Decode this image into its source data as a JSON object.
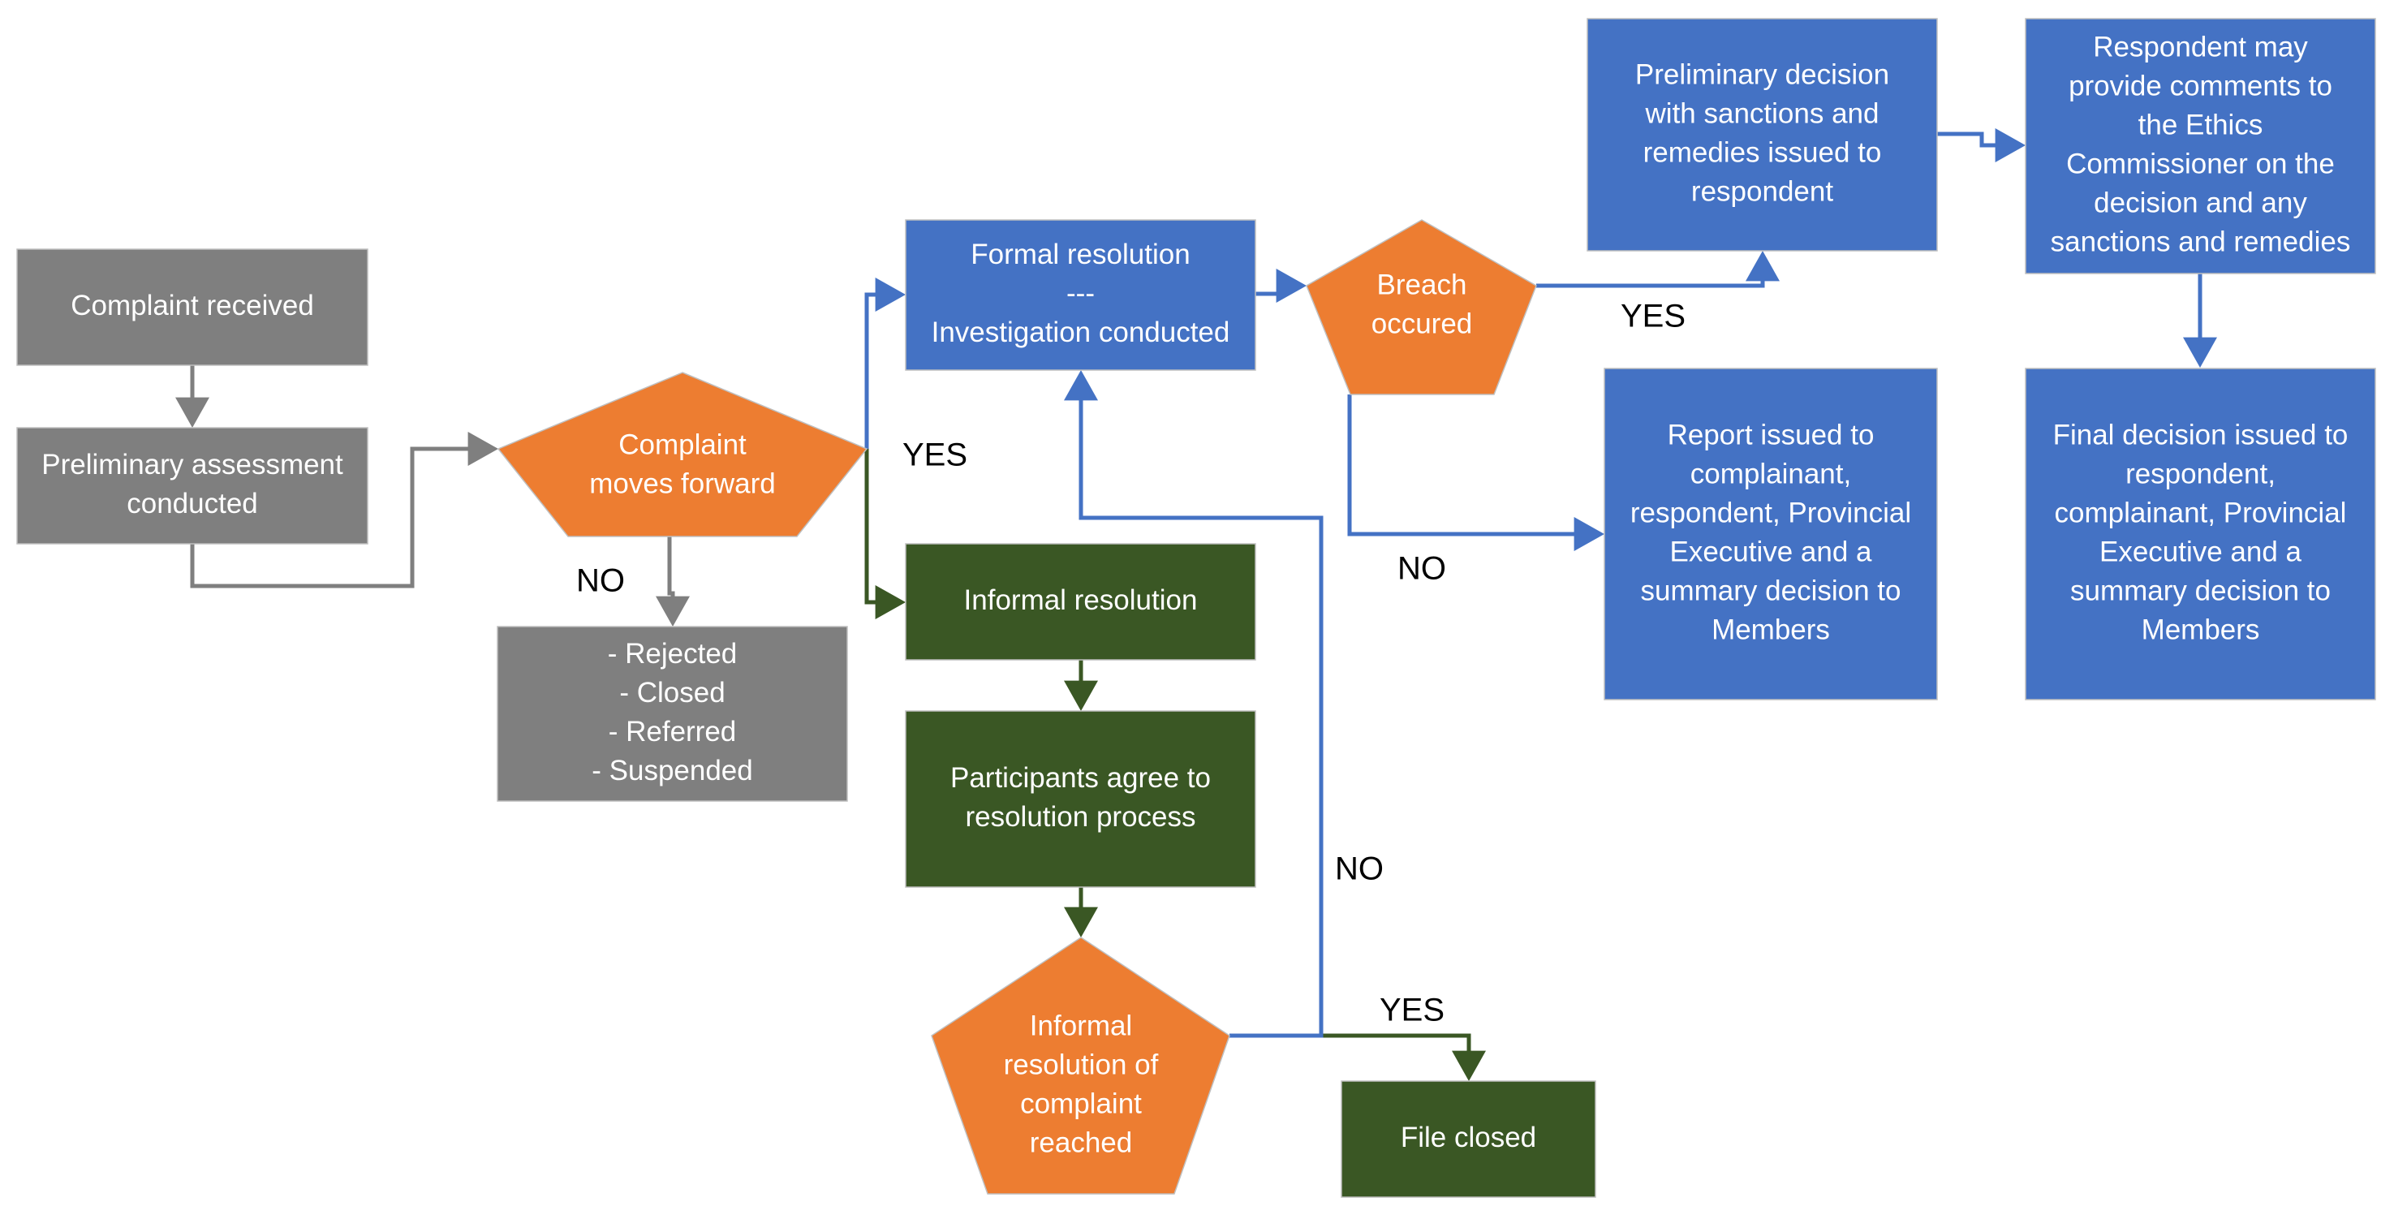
{
  "colors": {
    "gray": "#7F7F7F",
    "orange": "#ED7D31",
    "blue": "#4472C4",
    "green": "#3A5724",
    "label": "#000000"
  },
  "nodes": {
    "complaint_received": {
      "shape": "box",
      "color": "gray",
      "lines": [
        "Complaint received"
      ]
    },
    "preliminary_assessment": {
      "shape": "box",
      "color": "gray",
      "lines": [
        "Preliminary assessment",
        "conducted"
      ]
    },
    "complaint_moves_forward": {
      "shape": "decision",
      "color": "orange",
      "lines": [
        "Complaint",
        "moves forward"
      ]
    },
    "outcomes_no": {
      "shape": "box",
      "color": "gray",
      "lines": [
        "- Rejected",
        "- Closed",
        "- Referred",
        "- Suspended"
      ]
    },
    "formal_resolution": {
      "shape": "box",
      "color": "blue",
      "lines": [
        "Formal resolution",
        "---",
        "Investigation conducted"
      ]
    },
    "informal_resolution": {
      "shape": "box",
      "color": "green",
      "lines": [
        "Informal resolution"
      ]
    },
    "participants_agree": {
      "shape": "box",
      "color": "green",
      "lines": [
        "Participants agree to",
        "resolution process"
      ]
    },
    "informal_reached": {
      "shape": "decision",
      "color": "orange",
      "lines": [
        "Informal",
        "resolution of",
        "complaint",
        "reached"
      ]
    },
    "file_closed": {
      "shape": "box",
      "color": "green",
      "lines": [
        "File closed"
      ]
    },
    "breach_occured": {
      "shape": "decision",
      "color": "orange",
      "lines": [
        "Breach",
        "occured"
      ]
    },
    "preliminary_decision": {
      "shape": "box",
      "color": "blue",
      "lines": [
        "Preliminary decision",
        "with sanctions and",
        "remedies issued to",
        "respondent"
      ]
    },
    "respondent_comments": {
      "shape": "box",
      "color": "blue",
      "lines": [
        "Respondent may",
        "provide comments to",
        "the Ethics",
        "Commissioner on the",
        "decision and any",
        "sanctions and remedies"
      ]
    },
    "report_issued": {
      "shape": "box",
      "color": "blue",
      "lines": [
        "Report issued to",
        "complainant,",
        "respondent, Provincial",
        "Executive and a",
        "summary decision to",
        "Members"
      ]
    },
    "final_decision": {
      "shape": "box",
      "color": "blue",
      "lines": [
        "Final decision issued to",
        "respondent,",
        "complainant, Provincial",
        "Executive and a",
        "summary decision to",
        "Members"
      ]
    }
  },
  "edges": [
    {
      "from": "complaint_received",
      "to": "preliminary_assessment",
      "color": "gray",
      "label": ""
    },
    {
      "from": "preliminary_assessment",
      "to": "complaint_moves_forward",
      "color": "gray",
      "label": ""
    },
    {
      "from": "complaint_moves_forward",
      "to": "outcomes_no",
      "color": "gray",
      "label": "NO"
    },
    {
      "from": "complaint_moves_forward",
      "to": "formal_resolution",
      "color": "blue",
      "label": "YES"
    },
    {
      "from": "complaint_moves_forward",
      "to": "informal_resolution",
      "color": "green",
      "label": "YES"
    },
    {
      "from": "informal_resolution",
      "to": "participants_agree",
      "color": "green",
      "label": ""
    },
    {
      "from": "participants_agree",
      "to": "informal_reached",
      "color": "green",
      "label": ""
    },
    {
      "from": "informal_reached",
      "to": "file_closed",
      "color": "green",
      "label": "YES"
    },
    {
      "from": "informal_reached",
      "to": "formal_resolution",
      "color": "blue",
      "label": "NO"
    },
    {
      "from": "formal_resolution",
      "to": "breach_occured",
      "color": "blue",
      "label": ""
    },
    {
      "from": "breach_occured",
      "to": "preliminary_decision",
      "color": "blue",
      "label": "YES"
    },
    {
      "from": "breach_occured",
      "to": "report_issued",
      "color": "blue",
      "label": "NO"
    },
    {
      "from": "preliminary_decision",
      "to": "respondent_comments",
      "color": "blue",
      "label": ""
    },
    {
      "from": "respondent_comments",
      "to": "final_decision",
      "color": "blue",
      "label": ""
    }
  ],
  "labels": {
    "no_rejected": "NO",
    "yes_forward": "YES",
    "yes_breach": "YES",
    "no_breach": "NO",
    "no_informal": "NO",
    "yes_file_closed": "YES"
  }
}
